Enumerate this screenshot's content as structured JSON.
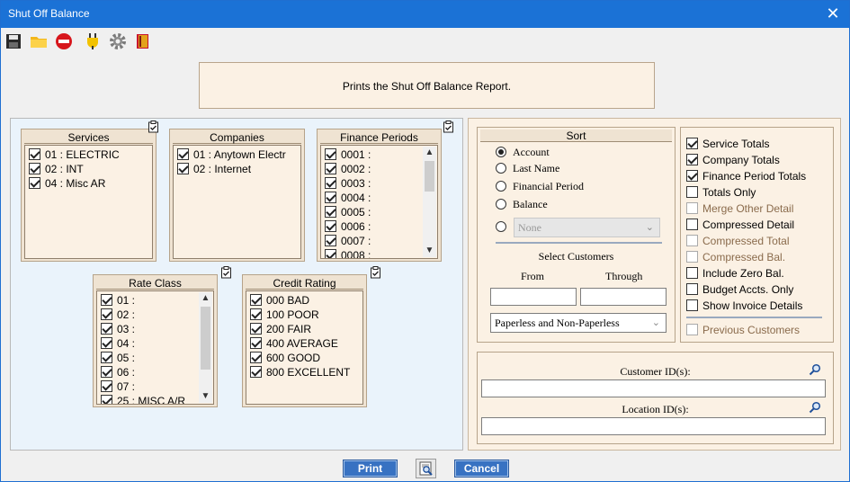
{
  "window": {
    "title": "Shut Off Balance",
    "close_glyph": "✕"
  },
  "toolbar": {
    "icons": [
      "save-icon",
      "folder-icon",
      "stop-icon",
      "plug-icon",
      "gear-icon",
      "book-icon"
    ]
  },
  "banner": {
    "text": "Prints the Shut Off Balance Report."
  },
  "services": {
    "title": "Services",
    "items": [
      {
        "label": "01 : ELECTRIC",
        "checked": true
      },
      {
        "label": "02 : INT",
        "checked": true
      },
      {
        "label": "04 : Misc AR",
        "checked": true
      }
    ]
  },
  "companies": {
    "title": "Companies",
    "items": [
      {
        "label": "01 : Anytown Electr",
        "checked": true
      },
      {
        "label": "02 : Internet",
        "checked": true
      }
    ]
  },
  "finance_periods": {
    "title": "Finance Periods",
    "items": [
      {
        "label": "0001 :",
        "checked": true
      },
      {
        "label": "0002 :",
        "checked": true
      },
      {
        "label": "0003 :",
        "checked": true
      },
      {
        "label": "0004 :",
        "checked": true
      },
      {
        "label": "0005 :",
        "checked": true
      },
      {
        "label": "0006 :",
        "checked": true
      },
      {
        "label": "0007 :",
        "checked": true
      },
      {
        "label": "0008 :",
        "checked": true
      }
    ]
  },
  "rate_class": {
    "title": "Rate Class",
    "items": [
      {
        "label": "01 :",
        "checked": true
      },
      {
        "label": "02 :",
        "checked": true
      },
      {
        "label": "03 :",
        "checked": true
      },
      {
        "label": "04 :",
        "checked": true
      },
      {
        "label": "05 :",
        "checked": true
      },
      {
        "label": "06 :",
        "checked": true
      },
      {
        "label": "07 :",
        "checked": true
      },
      {
        "label": "25 : MISC A/R",
        "checked": true
      }
    ]
  },
  "credit_rating": {
    "title": "Credit Rating",
    "items": [
      {
        "label": "000 BAD",
        "checked": true
      },
      {
        "label": "100 POOR",
        "checked": true
      },
      {
        "label": "200 FAIR",
        "checked": true
      },
      {
        "label": "400 AVERAGE",
        "checked": true
      },
      {
        "label": "600 GOOD",
        "checked": true
      },
      {
        "label": "800 EXCELLENT",
        "checked": true
      }
    ]
  },
  "sort": {
    "title": "Sort",
    "options": [
      {
        "label": "Account",
        "selected": true
      },
      {
        "label": "Last Name",
        "selected": false
      },
      {
        "label": "Financial Period",
        "selected": false
      },
      {
        "label": "Balance",
        "selected": false
      }
    ],
    "extra_select_value": "None",
    "select_customers_label": "Select Customers",
    "from_label": "From",
    "through_label": "Through",
    "from_value": "",
    "through_value": "",
    "paperless_value": "Paperless and Non-Paperless"
  },
  "options": {
    "items": [
      {
        "label": "Service Totals",
        "checked": true,
        "disabled": false
      },
      {
        "label": "Company Totals",
        "checked": true,
        "disabled": false
      },
      {
        "label": "Finance Period Totals",
        "checked": true,
        "disabled": false
      },
      {
        "label": "Totals Only",
        "checked": false,
        "disabled": false
      },
      {
        "label": "Merge Other Detail",
        "checked": false,
        "disabled": true
      },
      {
        "label": "Compressed Detail",
        "checked": false,
        "disabled": false
      },
      {
        "label": "Compressed Total",
        "checked": false,
        "disabled": true
      },
      {
        "label": "Compressed Bal.",
        "checked": false,
        "disabled": true
      },
      {
        "label": "Include Zero Bal.",
        "checked": false,
        "disabled": false
      },
      {
        "label": "Budget Accts. Only",
        "checked": false,
        "disabled": false
      },
      {
        "label": "Show Invoice Details",
        "checked": false,
        "disabled": false
      }
    ],
    "previous_customers": {
      "label": "Previous Customers",
      "checked": false,
      "disabled": true
    }
  },
  "ids": {
    "customer_label": "Customer ID(s):",
    "customer_value": "",
    "location_label": "Location ID(s):",
    "location_value": ""
  },
  "buttons": {
    "print": "Print",
    "preview_icon": "print-preview-icon",
    "cancel": "Cancel"
  },
  "colors": {
    "titlebar": "#1b72d6",
    "panel_beige": "#fbf1e4",
    "left_panel": "#eaf3fb",
    "button_blue": "#3872c2"
  }
}
